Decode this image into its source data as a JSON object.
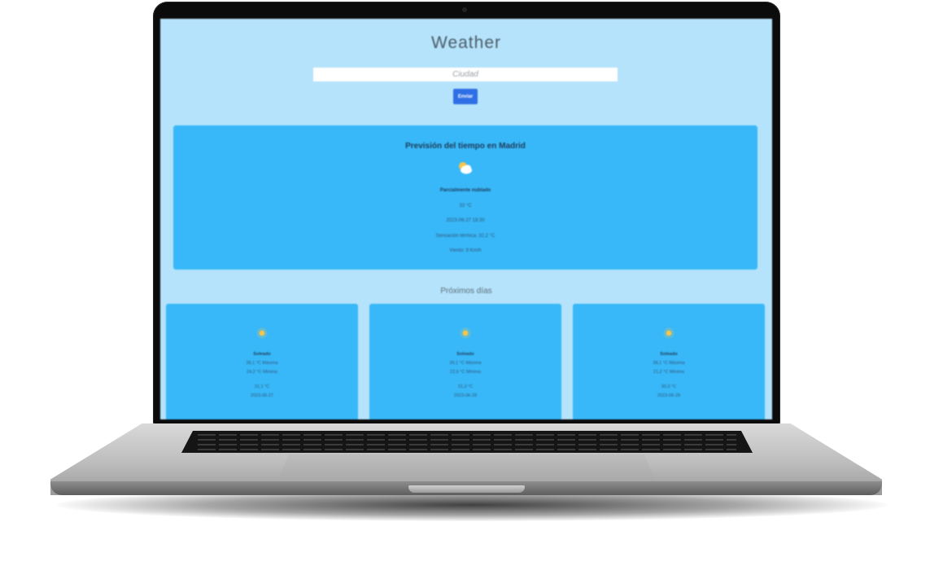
{
  "app": {
    "title": "Weather",
    "search": {
      "placeholder": "Ciudad",
      "value": ""
    },
    "send_label": "Enviar"
  },
  "current": {
    "title": "Previsión del tiempo en Madrid",
    "icon": "partly-cloudy-icon",
    "condition": "Parcialmente nublado",
    "temperature": "33 °C",
    "datetime": "2023-06-27 18:30",
    "feels_like": "Sensación térmica: 32,2 °C",
    "wind": "Viento: 9 Km/h"
  },
  "next_days": {
    "title": "Próximos días",
    "days": [
      {
        "icon": "sun-icon",
        "condition": "Soleado",
        "max": "38,1 °C Máxima",
        "min": "24,2 °C Mínima",
        "avg": "31,1 °C",
        "date": "2023-06-27"
      },
      {
        "icon": "sun-icon",
        "condition": "Soleado",
        "max": "39,1 °C Máxima",
        "min": "22,9 °C Mínima",
        "avg": "31,3 °C",
        "date": "2023-06-28"
      },
      {
        "icon": "sun-icon",
        "condition": "Soleado",
        "max": "38,1 °C Máxima",
        "min": "21,2 °C Mínima",
        "avg": "30,3 °C",
        "date": "2023-06-29"
      }
    ]
  },
  "colors": {
    "page_bg": "#b5e3fb",
    "card_bg": "#38b8f8",
    "button_bg": "#2f6fe6"
  }
}
